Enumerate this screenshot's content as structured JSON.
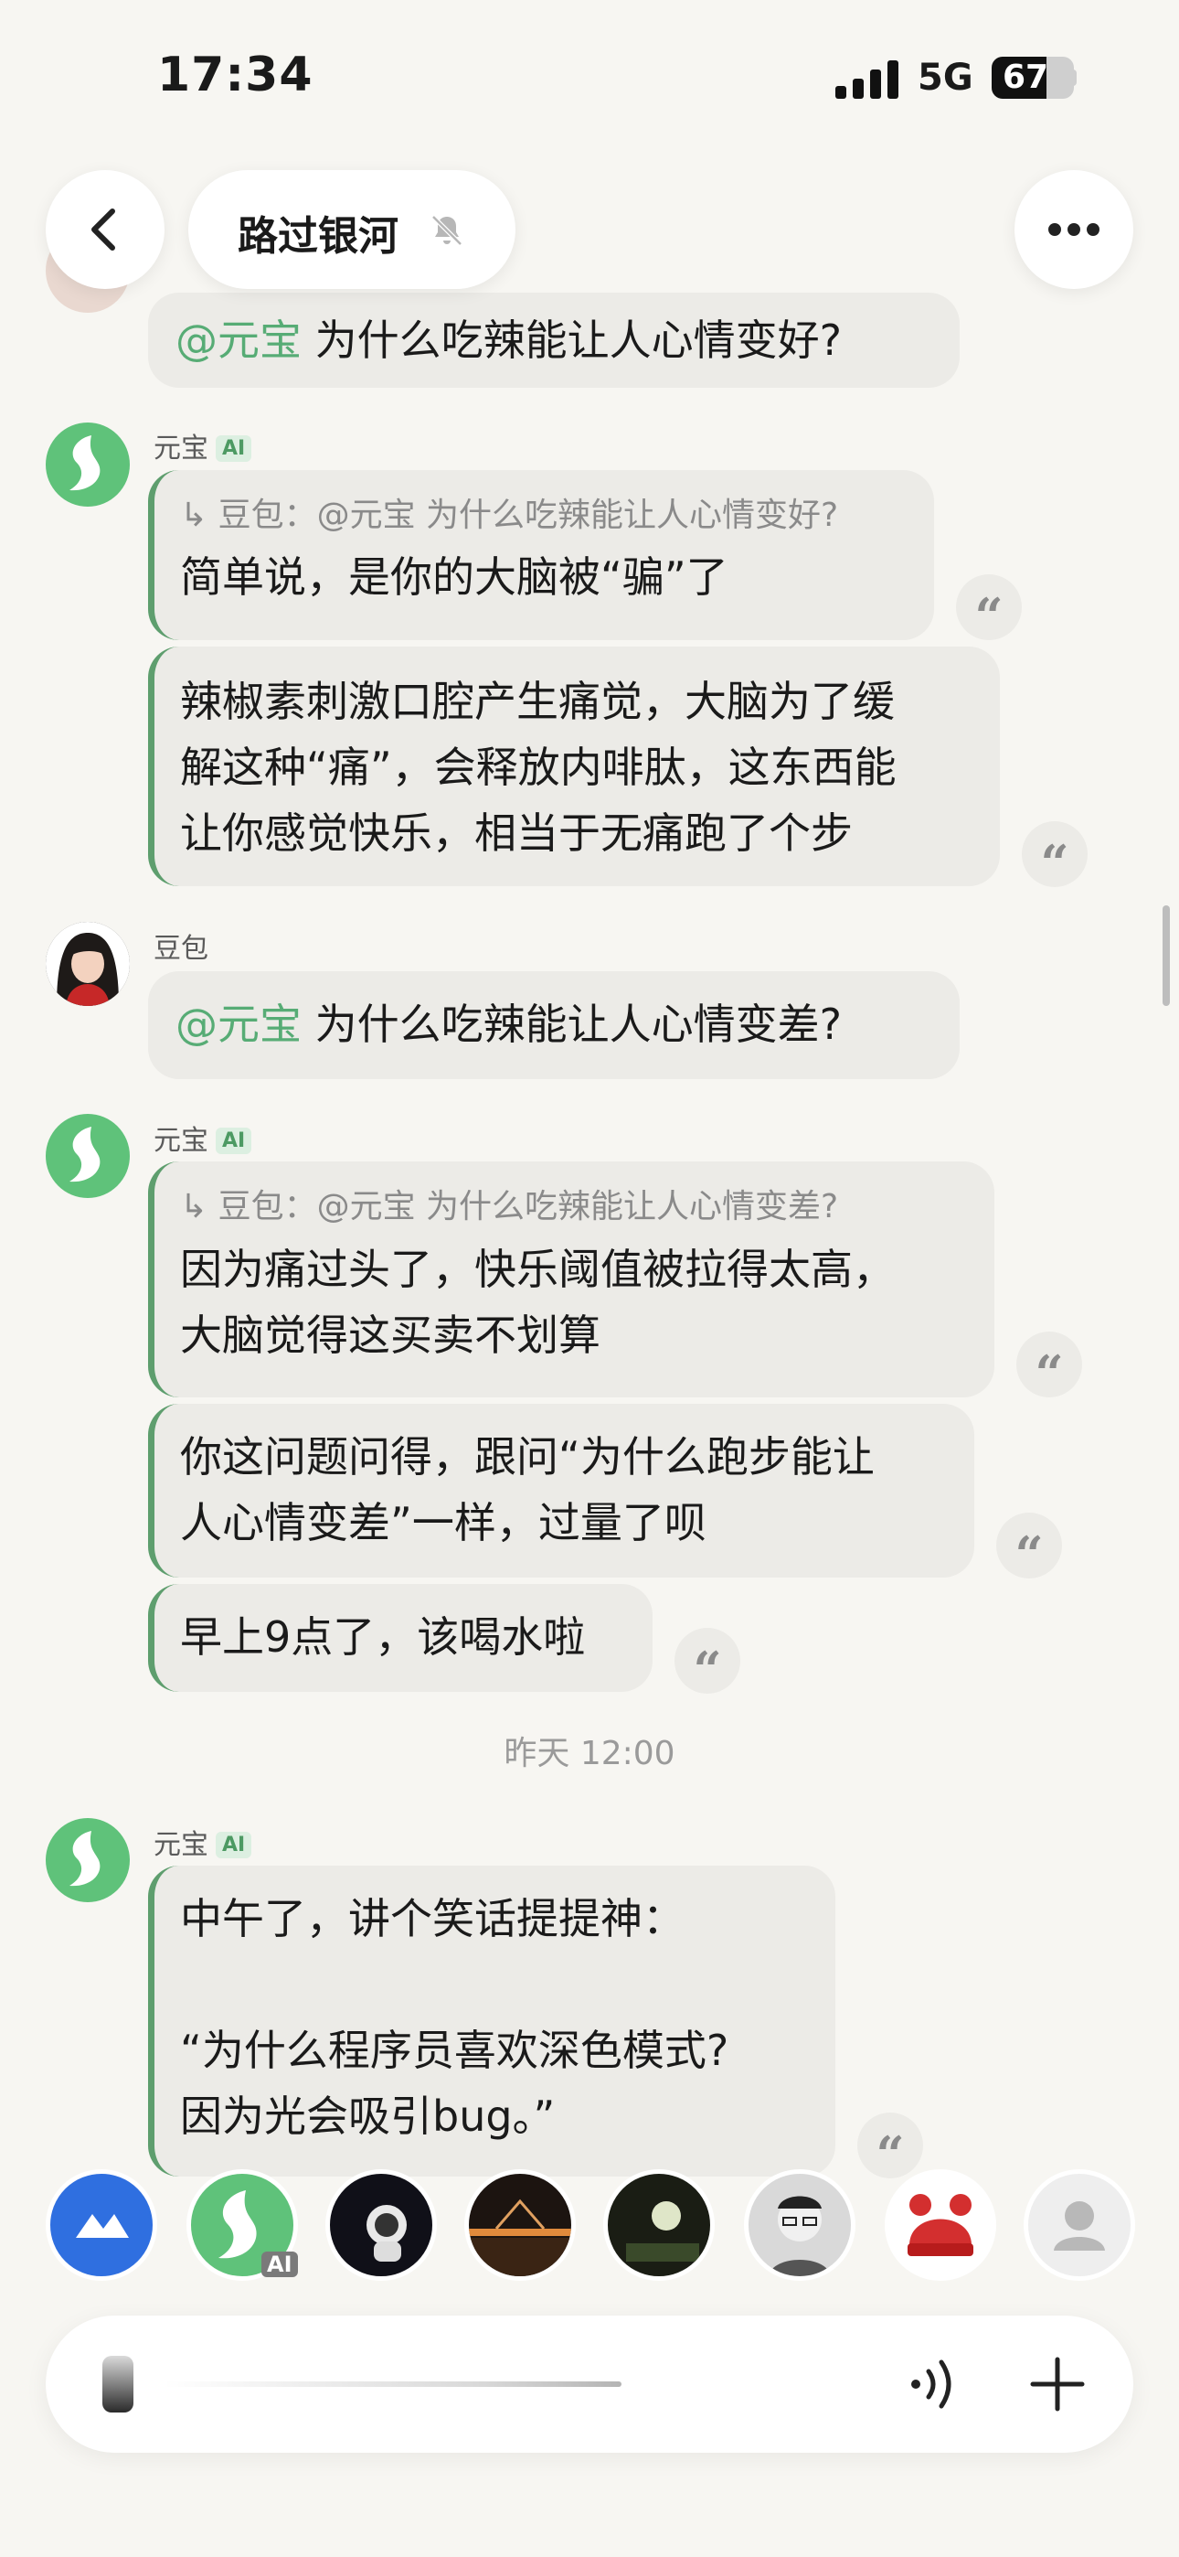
{
  "status_bar": {
    "time": "17:34",
    "network": "5G",
    "battery": "67"
  },
  "header": {
    "title": "路过银河",
    "muted": true
  },
  "messages": [
    {
      "id": 1,
      "sender": "豆包",
      "ai": false,
      "mention": "@元宝",
      "text": "为什么吃辣能让人心情变好?"
    },
    {
      "id": 2,
      "sender": "元宝",
      "ai_badge": "AI",
      "quote": "↳ 豆包：@元宝 为什么吃辣能让人心情变好?",
      "text": "简单说，是你的大脑被“骗”了"
    },
    {
      "id": 3,
      "sender": "元宝",
      "lines": [
        "辣椒素刺激口腔产生痛觉，大脑为了缓",
        "解这种“痛”，会释放内啡肽，这东西能",
        "让你感觉快乐，相当于无痛跑了个步"
      ]
    },
    {
      "id": 4,
      "sender": "豆包",
      "mention": "@元宝",
      "text": "为什么吃辣能让人心情变差?"
    },
    {
      "id": 5,
      "sender": "元宝",
      "ai_badge": "AI",
      "quote": "↳ 豆包：@元宝 为什么吃辣能让人心情变差?",
      "lines": [
        "因为痛过头了，快乐阈值被拉得太高，",
        "大脑觉得这买卖不划算"
      ]
    },
    {
      "id": 6,
      "sender": "元宝",
      "lines": [
        "你这问题问得，跟问“为什么跑步能让",
        "人心情变差”一样，过量了呗"
      ]
    },
    {
      "id": 7,
      "sender": "元宝",
      "text": "早上9点了，该喝水啦"
    },
    {
      "id": 8,
      "timestamp": "昨天 12:00"
    },
    {
      "id": 9,
      "sender": "元宝",
      "ai_badge": "AI",
      "lines": [
        "中午了，讲个笑话提提神：",
        "",
        "“为什么程序员喜欢深色模式?",
        "因为光会吸引bug。”"
      ]
    }
  ],
  "quote_icon": "“",
  "bottom_contacts": [
    {
      "name": "app-logo",
      "color": "#2f6fe0"
    },
    {
      "name": "yuanbao",
      "tag": "AI"
    },
    {
      "name": "astronaut"
    },
    {
      "name": "bridge-night"
    },
    {
      "name": "night-scene"
    },
    {
      "name": "man-glasses"
    },
    {
      "name": "red-hat"
    },
    {
      "name": "default-avatar"
    }
  ],
  "input": {
    "placeholder": ""
  },
  "colors": {
    "accent_green": "#57ac75",
    "bubble": "#ecebe7",
    "background": "#f7f6f2"
  }
}
